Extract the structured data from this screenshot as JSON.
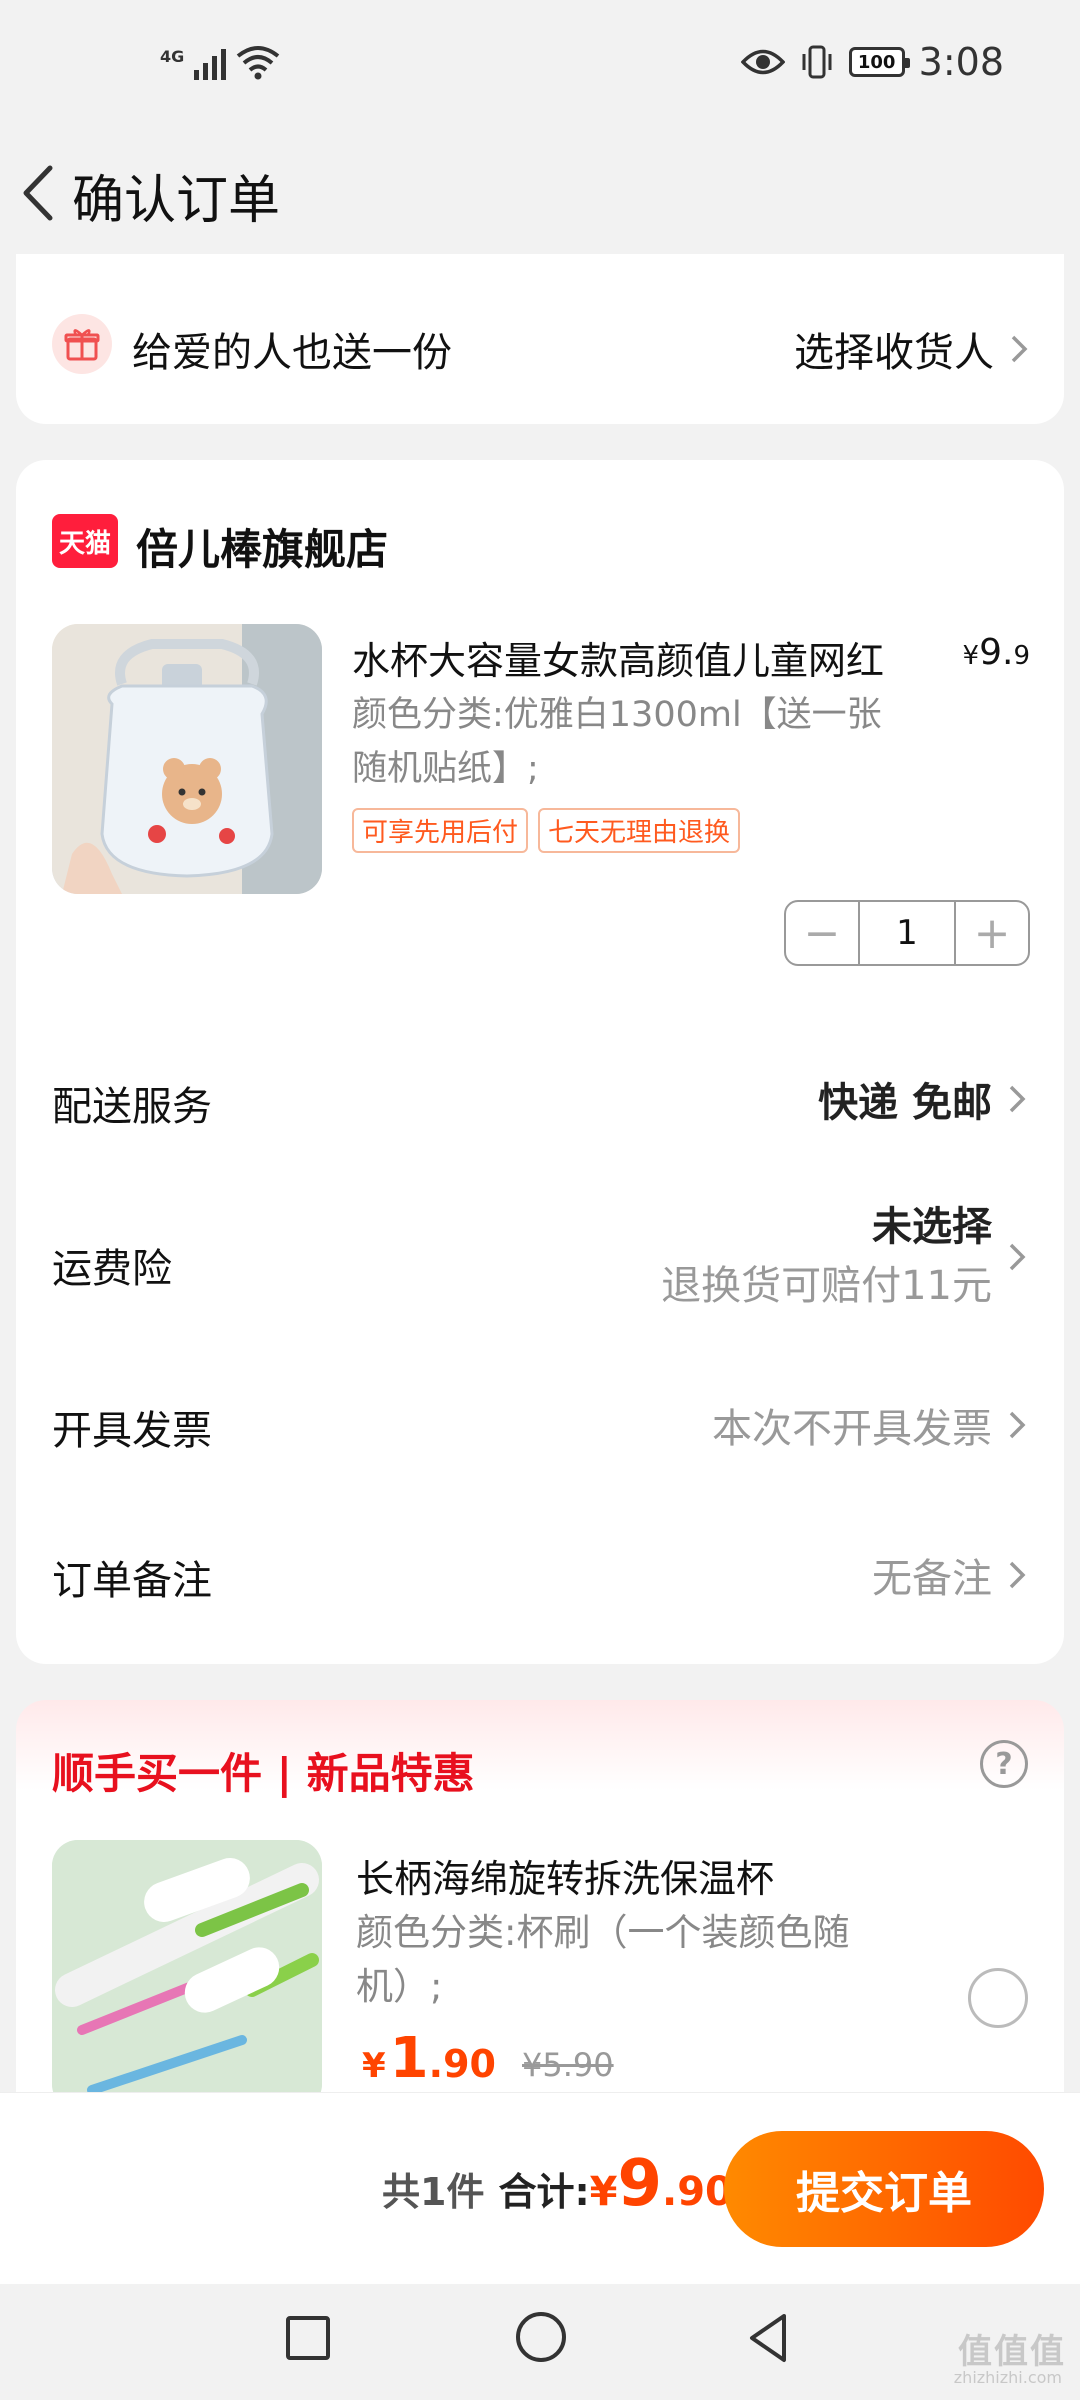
{
  "status_bar": {
    "network": "4G",
    "time": "3:08",
    "battery": "100"
  },
  "nav": {
    "title": "确认订单"
  },
  "gift": {
    "text": "给爱的人也送一份",
    "action": "选择收货人"
  },
  "shop": {
    "logo_text": "天猫",
    "name": "倍儿棒旗舰店"
  },
  "product": {
    "title": "水杯大容量女款高颜值儿童网红",
    "price_symbol": "¥",
    "price_int": "9.",
    "price_dec": "9",
    "spec": "颜色分类:优雅白1300ml【送一张随机贴纸】;",
    "tags": [
      "可享先用后付",
      "七天无理由退换"
    ],
    "quantity": "1",
    "minus": "−",
    "plus": "+"
  },
  "rows": {
    "delivery": {
      "label": "配送服务",
      "value": "快递 免邮"
    },
    "insurance": {
      "label": "运费险",
      "value": "未选择",
      "sub": "退换货可赔付11元"
    },
    "invoice": {
      "label": "开具发票",
      "value": "本次不开具发票"
    },
    "remark": {
      "label": "订单备注",
      "value": "无备注"
    }
  },
  "recommend": {
    "title": "顺手买一件 | 新品特惠",
    "help": "?",
    "name": "长柄海绵旋转拆洗保温杯",
    "spec": "颜色分类:杯刷（一个装颜色随机）;",
    "price_symbol": "¥",
    "price_int": "1",
    "price_dec": ".90",
    "old_price": "¥5.90"
  },
  "bottom": {
    "count": "共1件",
    "total_label": "合计:",
    "total_symbol": "¥",
    "total_int": "9",
    "total_dec": ".90",
    "submit": "提交订单"
  },
  "watermark": {
    "text": "值值值",
    "sub": "zhizhizhi.com"
  },
  "colors": {
    "accent": "#ff4400",
    "tmall_red": "#ff1e3c",
    "rec_title": "#e8101e"
  }
}
